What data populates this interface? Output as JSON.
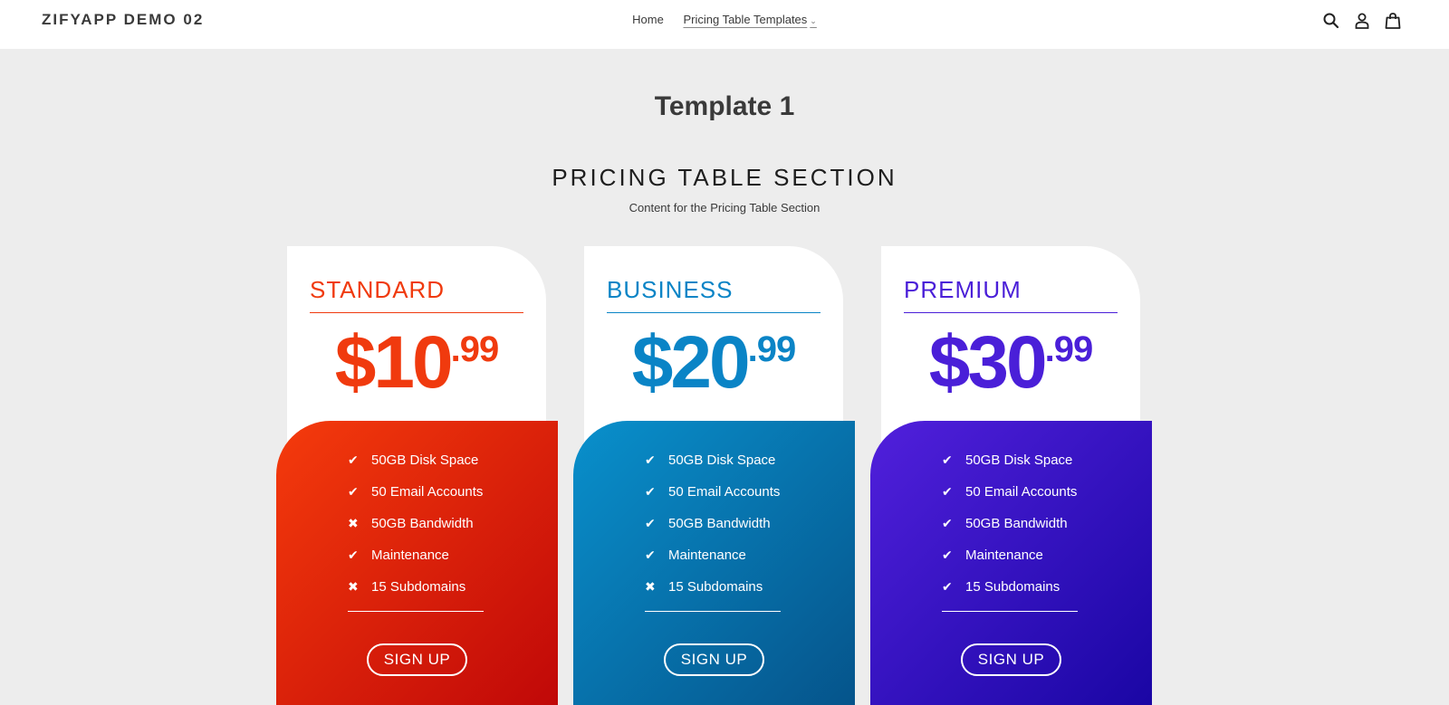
{
  "header": {
    "logo": "ZIFYAPP DEMO 02",
    "nav": [
      {
        "label": "Home"
      },
      {
        "label": "Pricing Table Templates"
      }
    ],
    "icons": [
      "search-icon",
      "account-icon",
      "cart-icon"
    ]
  },
  "page": {
    "title": "Template 1",
    "section_title": "PRICING TABLE SECTION",
    "section_subtitle": "Content for the Pricing Table Section"
  },
  "plans": [
    {
      "name": "STANDARD",
      "price_whole": "$10",
      "price_cents": ".99",
      "accent": "#f03a0e",
      "gradient": [
        "#f53b0c",
        "#c00808"
      ],
      "features": [
        {
          "label": "50GB Disk Space",
          "included": true
        },
        {
          "label": "50 Email Accounts",
          "included": true
        },
        {
          "label": "50GB Bandwidth",
          "included": false
        },
        {
          "label": "Maintenance",
          "included": true
        },
        {
          "label": "15 Subdomains",
          "included": false
        }
      ],
      "button": "SIGN UP"
    },
    {
      "name": "BUSINESS",
      "price_whole": "$20",
      "price_cents": ".99",
      "accent": "#0a84c6",
      "gradient": [
        "#0990cc",
        "#05548b"
      ],
      "features": [
        {
          "label": "50GB Disk Space",
          "included": true
        },
        {
          "label": "50 Email Accounts",
          "included": true
        },
        {
          "label": "50GB Bandwidth",
          "included": true
        },
        {
          "label": "Maintenance",
          "included": true
        },
        {
          "label": "15 Subdomains",
          "included": false
        }
      ],
      "button": "SIGN UP"
    },
    {
      "name": "PREMIUM",
      "price_whole": "$30",
      "price_cents": ".99",
      "accent": "#4a1fd8",
      "gradient": [
        "#5120dc",
        "#1a06a4"
      ],
      "features": [
        {
          "label": "50GB Disk Space",
          "included": true
        },
        {
          "label": "50 Email Accounts",
          "included": true
        },
        {
          "label": "50GB Bandwidth",
          "included": true
        },
        {
          "label": "Maintenance",
          "included": true
        },
        {
          "label": "15 Subdomains",
          "included": true
        }
      ],
      "button": "SIGN UP"
    }
  ]
}
